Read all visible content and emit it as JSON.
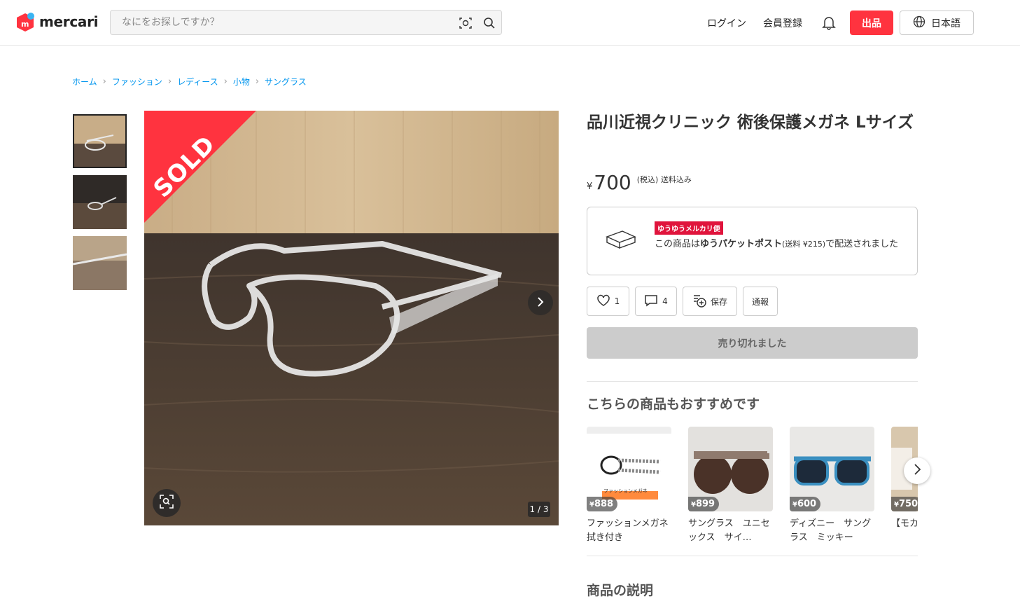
{
  "header": {
    "logo_text": "mercari",
    "search_placeholder": "なにをお探しですか？",
    "login": "ログイン",
    "signup": "会員登録",
    "sell": "出品",
    "language": "日本語"
  },
  "breadcrumb": [
    "ホーム",
    "ファッション",
    "レディース",
    "小物",
    "サングラス"
  ],
  "gallery": {
    "sold_label": "SOLD",
    "counter": "1 / 3"
  },
  "product": {
    "title": "品川近視クリニック 術後保護メガネ Lサイズ",
    "price_yen": "¥",
    "price": "700",
    "price_note": "(税込) 送料込み"
  },
  "shipping": {
    "badge": "ゆうゆうメルカリ便",
    "text_pre": "この商品は",
    "text_bold": "ゆうパケットポスト",
    "text_small": "(送料 ¥215)",
    "text_post": "で配送されました"
  },
  "actions": {
    "like_count": "1",
    "comment_count": "4",
    "save": "保存",
    "report": "通報"
  },
  "sold_out_button": "売り切れました",
  "recommend": {
    "title": "こちらの商品もおすすめです",
    "items": [
      {
        "price": "888",
        "name": "ファッションメガネ　拭き付き",
        "overlay_text": "ファッションメガネ"
      },
      {
        "price": "899",
        "name": "サングラス　ユニセックス　サイ…"
      },
      {
        "price": "600",
        "name": "ディズニー　サングラス　ミッキー"
      },
      {
        "price": "750",
        "name": "【モカ サンク"
      }
    ]
  },
  "description_title": "商品の説明"
}
